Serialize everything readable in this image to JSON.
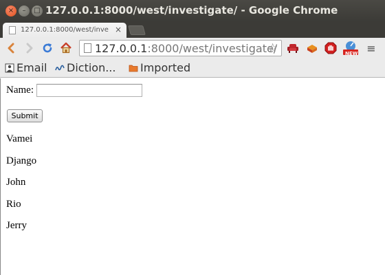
{
  "window": {
    "title": "127.0.0.1:8000/west/investigate/ - Google Chrome",
    "close_glyph": "×",
    "minimize_glyph": "–",
    "maximize_glyph": "□"
  },
  "tab": {
    "label": "127.0.0.1:8000/west/inve",
    "close_glyph": "×"
  },
  "toolbar": {
    "back_icon": "back-arrow-icon",
    "forward_icon": "forward-arrow-icon",
    "reload_icon": "reload-icon",
    "home_icon": "home-icon",
    "url_host": "127.0.0.1",
    "url_rest": ":8000/west/investigate/",
    "star_glyph": "☆",
    "menu_glyph": "≡",
    "new_badge": "NEW"
  },
  "bookmarks": [
    {
      "label": "Email",
      "icon": "email-bookmark-icon"
    },
    {
      "label": "Diction...",
      "icon": "dictionary-bookmark-icon"
    },
    {
      "label": "Imported",
      "icon": "folder-icon"
    }
  ],
  "form": {
    "name_label": "Name:",
    "name_value": "",
    "submit_label": "Submit"
  },
  "names": [
    "Vamei",
    "Django",
    "John",
    "Rio",
    "Jerry"
  ],
  "colors": {
    "titlebar": "#3c3b37",
    "close_button": "#e2511c",
    "reload_blue": "#3b7bd6",
    "home_red": "#c8402a"
  }
}
